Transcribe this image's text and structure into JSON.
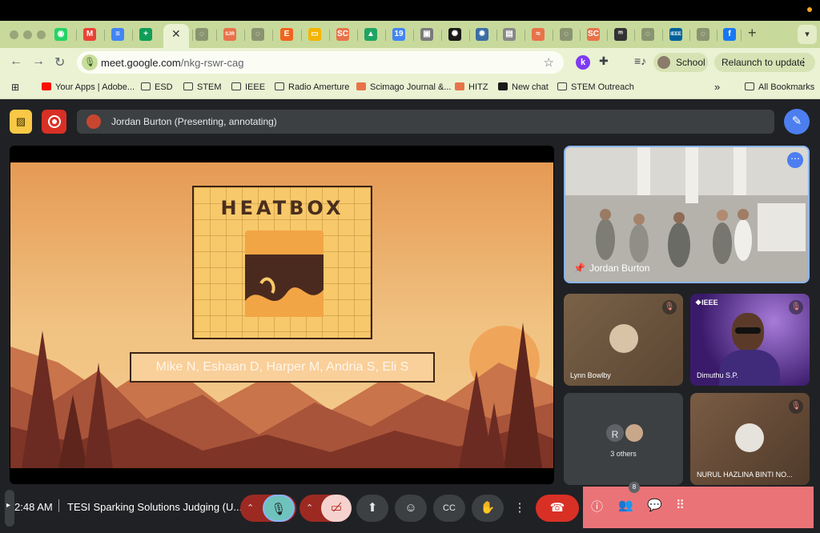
{
  "browser": {
    "active_tab_close": "✕",
    "new_tab": "+",
    "url_host": "meet.google.com",
    "url_path": "/nkg-rswr-cag",
    "profile_label": "School",
    "relaunch_label": "Relaunch to update",
    "extension_k": "k",
    "tab_icons": [
      {
        "name": "whatsapp-tab-icon",
        "glyph": "◉",
        "color": "#25d366"
      },
      {
        "name": "gmail-tab-icon",
        "glyph": "M",
        "color": "#ea4335"
      },
      {
        "name": "docs-tab-icon",
        "glyph": "≡",
        "color": "#4285f4"
      },
      {
        "name": "sheets-tab-icon",
        "glyph": "+",
        "color": "#0f9d58"
      },
      {
        "name": "loading-tab-icon",
        "glyph": "◌",
        "color": "#8a9470"
      },
      {
        "name": "sjr-tab-icon",
        "glyph": "SJR",
        "color": "#e8734a"
      },
      {
        "name": "loading-tab-icon-2",
        "glyph": "◌",
        "color": "#8a9470"
      },
      {
        "name": "etsy-tab-icon",
        "glyph": "E",
        "color": "#f1641e"
      },
      {
        "name": "slides-tab-icon",
        "glyph": "▭",
        "color": "#f4b400"
      },
      {
        "name": "sc-tab-icon",
        "glyph": "SC",
        "color": "#e8734a"
      },
      {
        "name": "drive-tab-icon",
        "glyph": "▲",
        "color": "#1fa463"
      },
      {
        "name": "calendar-tab-icon",
        "glyph": "19",
        "color": "#4285f4"
      },
      {
        "name": "image-tab-icon",
        "glyph": "▣",
        "color": "#7a7a7a"
      },
      {
        "name": "chatgpt-tab-icon",
        "glyph": "✺",
        "color": "#1a1a1a"
      },
      {
        "name": "gear-tab-icon",
        "glyph": "✹",
        "color": "#3b6ea5"
      },
      {
        "name": "page-tab-icon",
        "glyph": "▤",
        "color": "#888"
      },
      {
        "name": "hitz-tab-icon",
        "glyph": "≈",
        "color": "#e8734a"
      },
      {
        "name": "loading-tab-icon-3",
        "glyph": "◌",
        "color": "#8a9470"
      },
      {
        "name": "sc-tab-icon-2",
        "glyph": "SC",
        "color": "#e8734a"
      },
      {
        "name": "monday-tab-icon",
        "glyph": "ᵐ",
        "color": "#333"
      },
      {
        "name": "loading-tab-icon-4",
        "glyph": "◌",
        "color": "#8a9470"
      },
      {
        "name": "ieee-tab-icon",
        "glyph": "IEEE",
        "color": "#00629b"
      },
      {
        "name": "loading-tab-icon-5",
        "glyph": "◌",
        "color": "#8a9470"
      },
      {
        "name": "facebook-tab-icon",
        "glyph": "f",
        "color": "#1877f2"
      }
    ]
  },
  "bookmarks": [
    {
      "label": "Your Apps | Adobe...",
      "icon": "adobe-icon"
    },
    {
      "label": "ESD",
      "icon": "folder-icon"
    },
    {
      "label": "STEM",
      "icon": "folder-icon"
    },
    {
      "label": "IEEE",
      "icon": "folder-icon"
    },
    {
      "label": "Radio Amerture",
      "icon": "folder-icon"
    },
    {
      "label": "Scimago Journal &...",
      "icon": "sjr-icon"
    },
    {
      "label": "HITZ",
      "icon": "hitz-icon"
    },
    {
      "label": "New chat",
      "icon": "chatgpt-icon"
    },
    {
      "label": "STEM Outreach",
      "icon": "folder-icon"
    }
  ],
  "bookmarks_overflow": "»",
  "all_bookmarks": "All Bookmarks",
  "meet": {
    "presenter_bar": "Jordan Burton (Presenting, annotating)",
    "slide": {
      "title": "HEATBOX",
      "names": "Mike N, Eshaan D, Harper M, Andria S, Eli S"
    },
    "tiles": {
      "jordan": "Jordan Burton",
      "lynn": "Lynn Bowlby",
      "dimuthu": "Dimuthu S.P.",
      "dimuthu_badge": "❖IEEE",
      "others_initial": "R",
      "others": "3 others",
      "nurul": "NURUL HAZLINA BINTI NO..."
    },
    "bottom": {
      "time": "2:48 AM",
      "meeting": "TESI Sparking Solutions Judging (U...",
      "people_count": "8"
    }
  },
  "colors": {
    "tab_bar": "#c8d99c",
    "toolbar": "#eaf2d3",
    "meet_bg": "#202124",
    "accent_blue": "#8ab4f8",
    "leave_red": "#d93025",
    "side_panel": "#ea7377"
  }
}
